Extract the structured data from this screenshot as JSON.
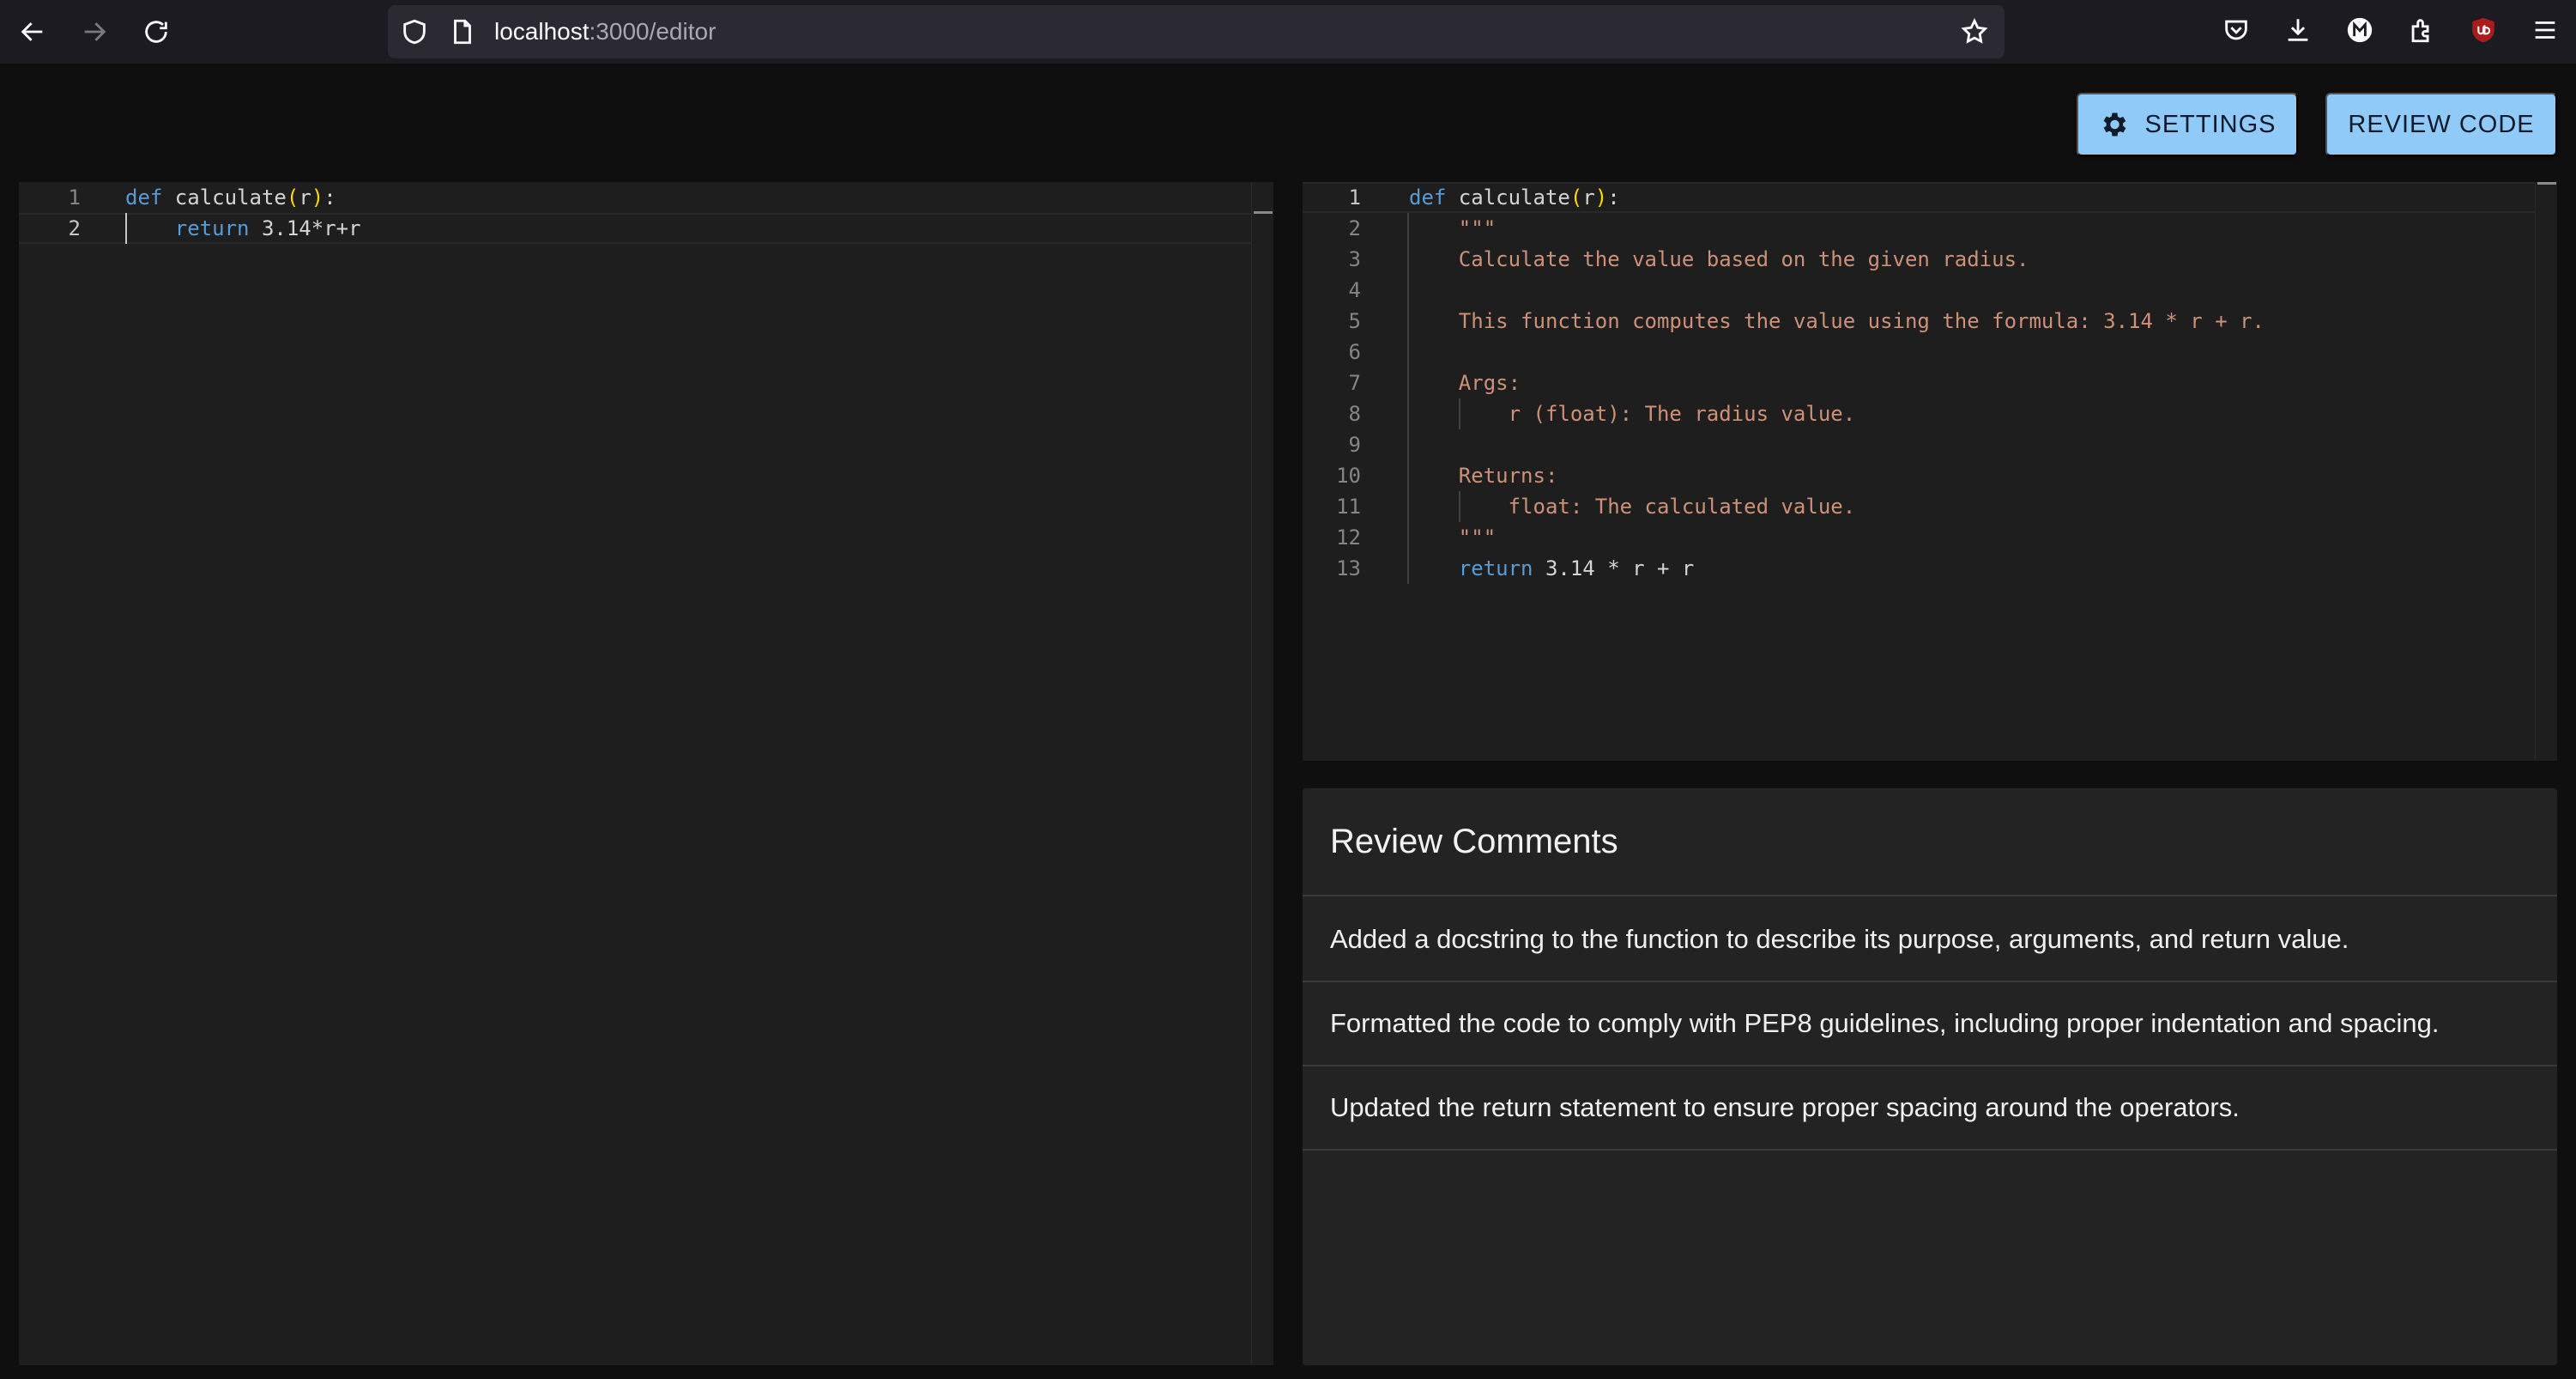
{
  "browser": {
    "url_host": "localhost",
    "url_path": ":3000/editor"
  },
  "toolbar": {
    "settings_label": "SETTINGS",
    "review_label": "REVIEW CODE"
  },
  "left_editor": {
    "lines": [
      {
        "n": "1",
        "parts": [
          {
            "t": "def",
            "c": "kw"
          },
          {
            "t": " calculate",
            "c": ""
          },
          {
            "t": "(",
            "c": "paren"
          },
          {
            "t": "r",
            "c": ""
          },
          {
            "t": ")",
            "c": "paren"
          },
          {
            "t": ":",
            "c": ""
          }
        ]
      },
      {
        "n": "2",
        "parts": [
          {
            "t": "    ",
            "c": ""
          },
          {
            "t": "return",
            "c": "kw"
          },
          {
            "t": " 3.14*r+r",
            "c": ""
          }
        ]
      }
    ]
  },
  "right_editor": {
    "lines": [
      {
        "n": "1",
        "parts": [
          {
            "t": "def",
            "c": "kw"
          },
          {
            "t": " calculate",
            "c": ""
          },
          {
            "t": "(",
            "c": "paren"
          },
          {
            "t": "r",
            "c": ""
          },
          {
            "t": ")",
            "c": "paren"
          },
          {
            "t": ":",
            "c": ""
          }
        ]
      },
      {
        "n": "2",
        "parts": [
          {
            "t": "    \"\"\"",
            "c": "str"
          }
        ]
      },
      {
        "n": "3",
        "parts": [
          {
            "t": "    Calculate the value based on the given radius.",
            "c": "str"
          }
        ]
      },
      {
        "n": "4",
        "parts": []
      },
      {
        "n": "5",
        "parts": [
          {
            "t": "    This function computes the value using the formula: 3.14 * r + r.",
            "c": "str"
          }
        ]
      },
      {
        "n": "6",
        "parts": []
      },
      {
        "n": "7",
        "parts": [
          {
            "t": "    Args:",
            "c": "str"
          }
        ]
      },
      {
        "n": "8",
        "parts": [
          {
            "t": "        r (float): The radius value.",
            "c": "str"
          }
        ]
      },
      {
        "n": "9",
        "parts": []
      },
      {
        "n": "10",
        "parts": [
          {
            "t": "    Returns:",
            "c": "str"
          }
        ]
      },
      {
        "n": "11",
        "parts": [
          {
            "t": "        float: The calculated value.",
            "c": "str"
          }
        ]
      },
      {
        "n": "12",
        "parts": [
          {
            "t": "    \"\"\"",
            "c": "str"
          }
        ]
      },
      {
        "n": "13",
        "parts": [
          {
            "t": "    ",
            "c": ""
          },
          {
            "t": "return",
            "c": "kw"
          },
          {
            "t": " 3.14 * r + r",
            "c": ""
          }
        ]
      }
    ]
  },
  "review": {
    "title": "Review Comments",
    "comments": [
      "Added a docstring to the function to describe its purpose, arguments, and return value.",
      "Formatted the code to comply with PEP8 guidelines, including proper indentation and spacing.",
      "Updated the return statement to ensure proper spacing around the operators."
    ]
  }
}
